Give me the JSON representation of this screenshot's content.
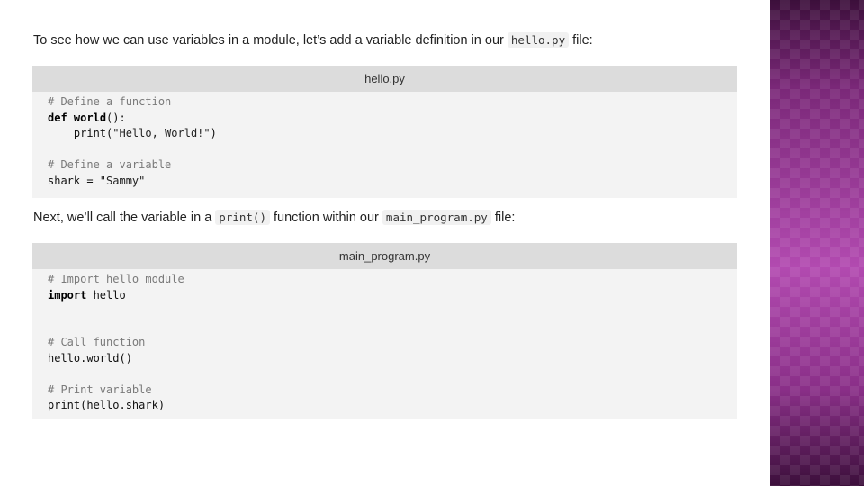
{
  "intro": {
    "before": "To see how we can use variables in a module, let’s add a variable definition in our ",
    "code": "hello.py",
    "after": " file:"
  },
  "block1": {
    "filename": "hello.py",
    "lines": {
      "comment1": "# Define a function",
      "def_kw": "def",
      "func_name": "world",
      "def_rest": "():",
      "print_indent": "    print(",
      "print_str": "\"Hello, World!\"",
      "print_close": ")",
      "comment2": "# Define a variable",
      "assign": "shark = ",
      "assign_str": "\"Sammy\""
    }
  },
  "second": {
    "before": "Next, we’ll call the variable in a ",
    "code1": "print()",
    "middle": " function within our ",
    "code2": "main_program.py",
    "after": " file:"
  },
  "block2": {
    "filename": "main_program.py",
    "lines": {
      "comment1": "# Import hello module",
      "import_kw": "import",
      "import_rest": " hello",
      "comment2": "# Call function",
      "call": "hello.world()",
      "comment3": "# Print variable",
      "print_call": "print(hello.shark)"
    }
  },
  "colors": {
    "side_accent": "#a13f9e",
    "code_bg": "#f3f3f3",
    "code_header_bg": "#dcdcdc"
  }
}
